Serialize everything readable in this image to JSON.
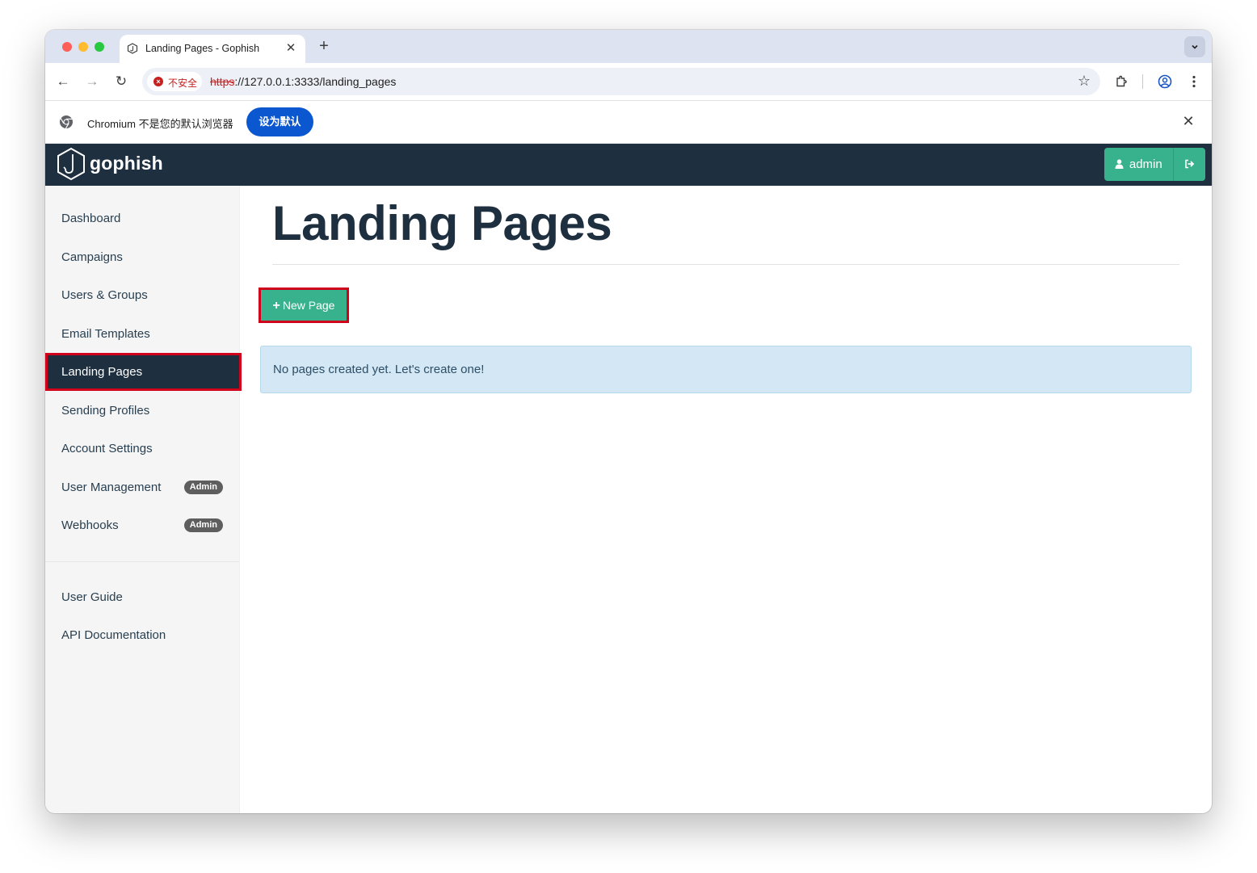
{
  "browser": {
    "tab_title": "Landing Pages - Gophish",
    "tab_close": "✕",
    "new_tab": "+",
    "tab_menu": "⌄",
    "insecure_label": "不安全",
    "url_scheme": "https",
    "url_rest": "://127.0.0.1:3333/landing_pages",
    "back": "←",
    "forward": "→",
    "reload": "↻",
    "bookmark": "☆"
  },
  "infobar": {
    "message": "Chromium 不是您的默认浏览器",
    "button_label": "设为默认",
    "close": "✕"
  },
  "app": {
    "brand": "gophish",
    "user_label": "admin",
    "user_glyph": "👤",
    "logout_glyph": "⇥"
  },
  "sidebar": {
    "items": [
      {
        "label": "Dashboard"
      },
      {
        "label": "Campaigns"
      },
      {
        "label": "Users & Groups"
      },
      {
        "label": "Email Templates"
      },
      {
        "label": "Landing Pages"
      },
      {
        "label": "Sending Profiles"
      },
      {
        "label": "Account Settings"
      },
      {
        "label": "User Management",
        "badge": "Admin"
      },
      {
        "label": "Webhooks",
        "badge": "Admin"
      }
    ],
    "bottom_items": [
      {
        "label": "User Guide"
      },
      {
        "label": "API Documentation"
      }
    ]
  },
  "main": {
    "title": "Landing Pages",
    "new_page_label": "New Page",
    "plus": "+",
    "empty_message": "No pages created yet. Let's create one!"
  },
  "colors": {
    "navbar": "#1e2f40",
    "accent_green": "#37b28c",
    "highlight_red": "#d0021b",
    "alert_bg": "#d3e7f4"
  }
}
